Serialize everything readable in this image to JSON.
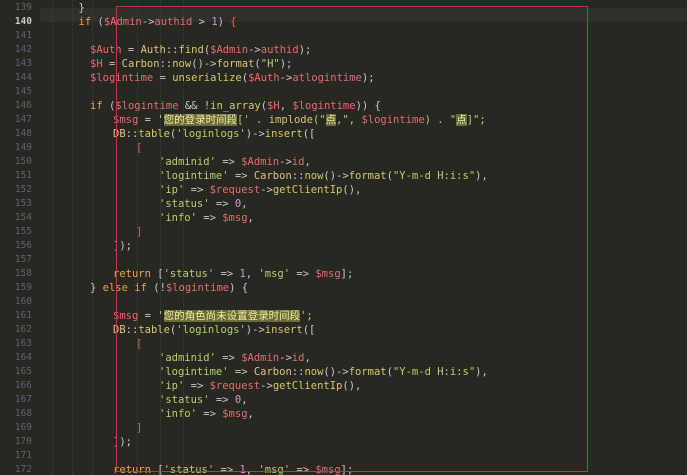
{
  "gutter": {
    "line_numbers": [
      "139",
      "140",
      "141",
      "142",
      "143",
      "144",
      "145",
      "146",
      "147",
      "148",
      "149",
      "150",
      "151",
      "152",
      "153",
      "154",
      "155",
      "156",
      "157",
      "158",
      "159",
      "160",
      "161",
      "162",
      "163",
      "164",
      "165",
      "166",
      "167",
      "168",
      "169",
      "170",
      "171",
      "172"
    ],
    "current_line": "140"
  },
  "code_lines": [
    {
      "indent": 6,
      "tokens": [
        {
          "t": "}",
          "c": "punc"
        }
      ]
    },
    {
      "indent": 6,
      "tokens": [
        {
          "t": "if",
          "c": "kw"
        },
        {
          "t": " (",
          "c": "punc"
        },
        {
          "t": "$Admin",
          "c": "var"
        },
        {
          "t": "->",
          "c": "op"
        },
        {
          "t": "authid",
          "c": "var"
        },
        {
          "t": " > ",
          "c": "op"
        },
        {
          "t": "1",
          "c": "num"
        },
        {
          "t": ") ",
          "c": "punc"
        },
        {
          "t": "{",
          "c": "brk"
        }
      ]
    },
    {
      "indent": 0,
      "tokens": []
    },
    {
      "indent": 8,
      "tokens": [
        {
          "t": "$Auth",
          "c": "var"
        },
        {
          "t": " = ",
          "c": "op"
        },
        {
          "t": "Auth",
          "c": "cls"
        },
        {
          "t": "::",
          "c": "op"
        },
        {
          "t": "find",
          "c": "fn"
        },
        {
          "t": "(",
          "c": "punc"
        },
        {
          "t": "$Admin",
          "c": "var"
        },
        {
          "t": "->",
          "c": "op"
        },
        {
          "t": "authid",
          "c": "var"
        },
        {
          "t": ");",
          "c": "punc"
        }
      ]
    },
    {
      "indent": 8,
      "tokens": [
        {
          "t": "$H",
          "c": "var"
        },
        {
          "t": " = ",
          "c": "op"
        },
        {
          "t": "Carbon",
          "c": "cls"
        },
        {
          "t": "::",
          "c": "op"
        },
        {
          "t": "now",
          "c": "fn"
        },
        {
          "t": "()->",
          "c": "punc"
        },
        {
          "t": "format",
          "c": "fn"
        },
        {
          "t": "(",
          "c": "punc"
        },
        {
          "t": "\"H\"",
          "c": "str"
        },
        {
          "t": ");",
          "c": "punc"
        }
      ]
    },
    {
      "indent": 8,
      "tokens": [
        {
          "t": "$logintime",
          "c": "var"
        },
        {
          "t": " = ",
          "c": "op"
        },
        {
          "t": "unserialize",
          "c": "fn"
        },
        {
          "t": "(",
          "c": "punc"
        },
        {
          "t": "$Auth",
          "c": "var"
        },
        {
          "t": "->",
          "c": "op"
        },
        {
          "t": "atlogintime",
          "c": "var"
        },
        {
          "t": ");",
          "c": "punc"
        }
      ]
    },
    {
      "indent": 0,
      "tokens": []
    },
    {
      "indent": 8,
      "tokens": [
        {
          "t": "if",
          "c": "kw"
        },
        {
          "t": " (",
          "c": "punc"
        },
        {
          "t": "$logintime",
          "c": "var"
        },
        {
          "t": " && !",
          "c": "op"
        },
        {
          "t": "in_array",
          "c": "fn"
        },
        {
          "t": "(",
          "c": "punc"
        },
        {
          "t": "$H",
          "c": "var"
        },
        {
          "t": ", ",
          "c": "punc"
        },
        {
          "t": "$logintime",
          "c": "var"
        },
        {
          "t": ")) {",
          "c": "punc"
        }
      ]
    },
    {
      "indent": 12,
      "tokens": [
        {
          "t": "$msg",
          "c": "var"
        },
        {
          "t": " = ",
          "c": "op"
        },
        {
          "t": "'",
          "c": "str"
        },
        {
          "t": "您的登录时间段",
          "c": "hl"
        },
        {
          "t": "[' . ",
          "c": "str"
        },
        {
          "t": "implode",
          "c": "fn"
        },
        {
          "t": "(\"",
          "c": "str"
        },
        {
          "t": "点",
          "c": "hl"
        },
        {
          "t": ",\", ",
          "c": "str"
        },
        {
          "t": "$logintime",
          "c": "var"
        },
        {
          "t": ") . \"",
          "c": "str"
        },
        {
          "t": "点",
          "c": "hl"
        },
        {
          "t": "]\";",
          "c": "str"
        }
      ]
    },
    {
      "indent": 12,
      "tokens": [
        {
          "t": "DB",
          "c": "cls"
        },
        {
          "t": "::",
          "c": "op"
        },
        {
          "t": "table",
          "c": "fn"
        },
        {
          "t": "(",
          "c": "punc"
        },
        {
          "t": "'loginlogs'",
          "c": "str"
        },
        {
          "t": ")->",
          "c": "punc"
        },
        {
          "t": "insert",
          "c": "fn"
        },
        {
          "t": "([",
          "c": "punc"
        }
      ]
    },
    {
      "indent": 16,
      "tokens": [
        {
          "t": "[",
          "c": "brk"
        }
      ]
    },
    {
      "indent": 20,
      "tokens": [
        {
          "t": "'adminid'",
          "c": "str"
        },
        {
          "t": " => ",
          "c": "op"
        },
        {
          "t": "$Admin",
          "c": "var"
        },
        {
          "t": "->",
          "c": "op"
        },
        {
          "t": "id",
          "c": "var"
        },
        {
          "t": ",",
          "c": "punc"
        }
      ]
    },
    {
      "indent": 20,
      "tokens": [
        {
          "t": "'logintime'",
          "c": "str"
        },
        {
          "t": " => ",
          "c": "op"
        },
        {
          "t": "Carbon",
          "c": "cls"
        },
        {
          "t": "::",
          "c": "op"
        },
        {
          "t": "now",
          "c": "fn"
        },
        {
          "t": "()->",
          "c": "punc"
        },
        {
          "t": "format",
          "c": "fn"
        },
        {
          "t": "(",
          "c": "punc"
        },
        {
          "t": "\"Y-m-d H:i:s\"",
          "c": "str"
        },
        {
          "t": "),",
          "c": "punc"
        }
      ]
    },
    {
      "indent": 20,
      "tokens": [
        {
          "t": "'ip'",
          "c": "str"
        },
        {
          "t": " => ",
          "c": "op"
        },
        {
          "t": "$request",
          "c": "var"
        },
        {
          "t": "->",
          "c": "op"
        },
        {
          "t": "getClientIp",
          "c": "fn"
        },
        {
          "t": "(),",
          "c": "punc"
        }
      ]
    },
    {
      "indent": 20,
      "tokens": [
        {
          "t": "'status'",
          "c": "str"
        },
        {
          "t": " => ",
          "c": "op"
        },
        {
          "t": "0",
          "c": "num"
        },
        {
          "t": ",",
          "c": "punc"
        }
      ]
    },
    {
      "indent": 20,
      "tokens": [
        {
          "t": "'info'",
          "c": "str"
        },
        {
          "t": " => ",
          "c": "op"
        },
        {
          "t": "$msg",
          "c": "var"
        },
        {
          "t": ",",
          "c": "punc"
        }
      ]
    },
    {
      "indent": 16,
      "tokens": [
        {
          "t": "]",
          "c": "brk"
        }
      ]
    },
    {
      "indent": 12,
      "tokens": [
        {
          "t": "]);",
          "c": "punc"
        }
      ]
    },
    {
      "indent": 0,
      "tokens": []
    },
    {
      "indent": 12,
      "tokens": [
        {
          "t": "return",
          "c": "kw"
        },
        {
          "t": " [",
          "c": "punc"
        },
        {
          "t": "'status'",
          "c": "str"
        },
        {
          "t": " => ",
          "c": "op"
        },
        {
          "t": "1",
          "c": "num"
        },
        {
          "t": ", ",
          "c": "punc"
        },
        {
          "t": "'msg'",
          "c": "str"
        },
        {
          "t": " => ",
          "c": "op"
        },
        {
          "t": "$msg",
          "c": "var"
        },
        {
          "t": "];",
          "c": "punc"
        }
      ]
    },
    {
      "indent": 8,
      "tokens": [
        {
          "t": "} ",
          "c": "punc"
        },
        {
          "t": "else if",
          "c": "kw"
        },
        {
          "t": " (!",
          "c": "punc"
        },
        {
          "t": "$logintime",
          "c": "var"
        },
        {
          "t": ") {",
          "c": "punc"
        }
      ]
    },
    {
      "indent": 0,
      "tokens": []
    },
    {
      "indent": 12,
      "tokens": [
        {
          "t": "$msg",
          "c": "var"
        },
        {
          "t": " = ",
          "c": "op"
        },
        {
          "t": "'",
          "c": "str"
        },
        {
          "t": "您的角色尚未设置登录时间段",
          "c": "hl"
        },
        {
          "t": "';",
          "c": "str"
        }
      ]
    },
    {
      "indent": 12,
      "tokens": [
        {
          "t": "DB",
          "c": "cls"
        },
        {
          "t": "::",
          "c": "op"
        },
        {
          "t": "table",
          "c": "fn"
        },
        {
          "t": "(",
          "c": "punc"
        },
        {
          "t": "'loginlogs'",
          "c": "str"
        },
        {
          "t": ")->",
          "c": "punc"
        },
        {
          "t": "insert",
          "c": "fn"
        },
        {
          "t": "([",
          "c": "punc"
        }
      ]
    },
    {
      "indent": 16,
      "tokens": [
        {
          "t": "[",
          "c": "brk"
        }
      ]
    },
    {
      "indent": 20,
      "tokens": [
        {
          "t": "'adminid'",
          "c": "str"
        },
        {
          "t": " => ",
          "c": "op"
        },
        {
          "t": "$Admin",
          "c": "var"
        },
        {
          "t": "->",
          "c": "op"
        },
        {
          "t": "id",
          "c": "var"
        },
        {
          "t": ",",
          "c": "punc"
        }
      ]
    },
    {
      "indent": 20,
      "tokens": [
        {
          "t": "'logintime'",
          "c": "str"
        },
        {
          "t": " => ",
          "c": "op"
        },
        {
          "t": "Carbon",
          "c": "cls"
        },
        {
          "t": "::",
          "c": "op"
        },
        {
          "t": "now",
          "c": "fn"
        },
        {
          "t": "()->",
          "c": "punc"
        },
        {
          "t": "format",
          "c": "fn"
        },
        {
          "t": "(",
          "c": "punc"
        },
        {
          "t": "\"Y-m-d H:i:s\"",
          "c": "str"
        },
        {
          "t": "),",
          "c": "punc"
        }
      ]
    },
    {
      "indent": 20,
      "tokens": [
        {
          "t": "'ip'",
          "c": "str"
        },
        {
          "t": " => ",
          "c": "op"
        },
        {
          "t": "$request",
          "c": "var"
        },
        {
          "t": "->",
          "c": "op"
        },
        {
          "t": "getClientIp",
          "c": "fn"
        },
        {
          "t": "(),",
          "c": "punc"
        }
      ]
    },
    {
      "indent": 20,
      "tokens": [
        {
          "t": "'status'",
          "c": "str"
        },
        {
          "t": " => ",
          "c": "op"
        },
        {
          "t": "0",
          "c": "num"
        },
        {
          "t": ",",
          "c": "punc"
        }
      ]
    },
    {
      "indent": 20,
      "tokens": [
        {
          "t": "'info'",
          "c": "str"
        },
        {
          "t": " => ",
          "c": "op"
        },
        {
          "t": "$msg",
          "c": "var"
        },
        {
          "t": ",",
          "c": "punc"
        }
      ]
    },
    {
      "indent": 16,
      "tokens": [
        {
          "t": "]",
          "c": "brk"
        }
      ]
    },
    {
      "indent": 12,
      "tokens": [
        {
          "t": "]);",
          "c": "punc"
        }
      ]
    },
    {
      "indent": 0,
      "tokens": []
    },
    {
      "indent": 12,
      "tokens": [
        {
          "t": "return",
          "c": "kw"
        },
        {
          "t": " [",
          "c": "punc"
        },
        {
          "t": "'status'",
          "c": "str"
        },
        {
          "t": " => ",
          "c": "op"
        },
        {
          "t": "1",
          "c": "num"
        },
        {
          "t": ", ",
          "c": "punc"
        },
        {
          "t": "'msg'",
          "c": "str"
        },
        {
          "t": " => ",
          "c": "op"
        },
        {
          "t": "$msg",
          "c": "var"
        },
        {
          "t": "];",
          "c": "punc"
        }
      ]
    }
  ],
  "colors": {
    "background": "#272822",
    "selection_border": "#b53b45",
    "keyword": "#f4a14a",
    "variable": "#e86a72",
    "function": "#d9c76a",
    "string": "#b7d26a",
    "number": "#d990e8"
  }
}
